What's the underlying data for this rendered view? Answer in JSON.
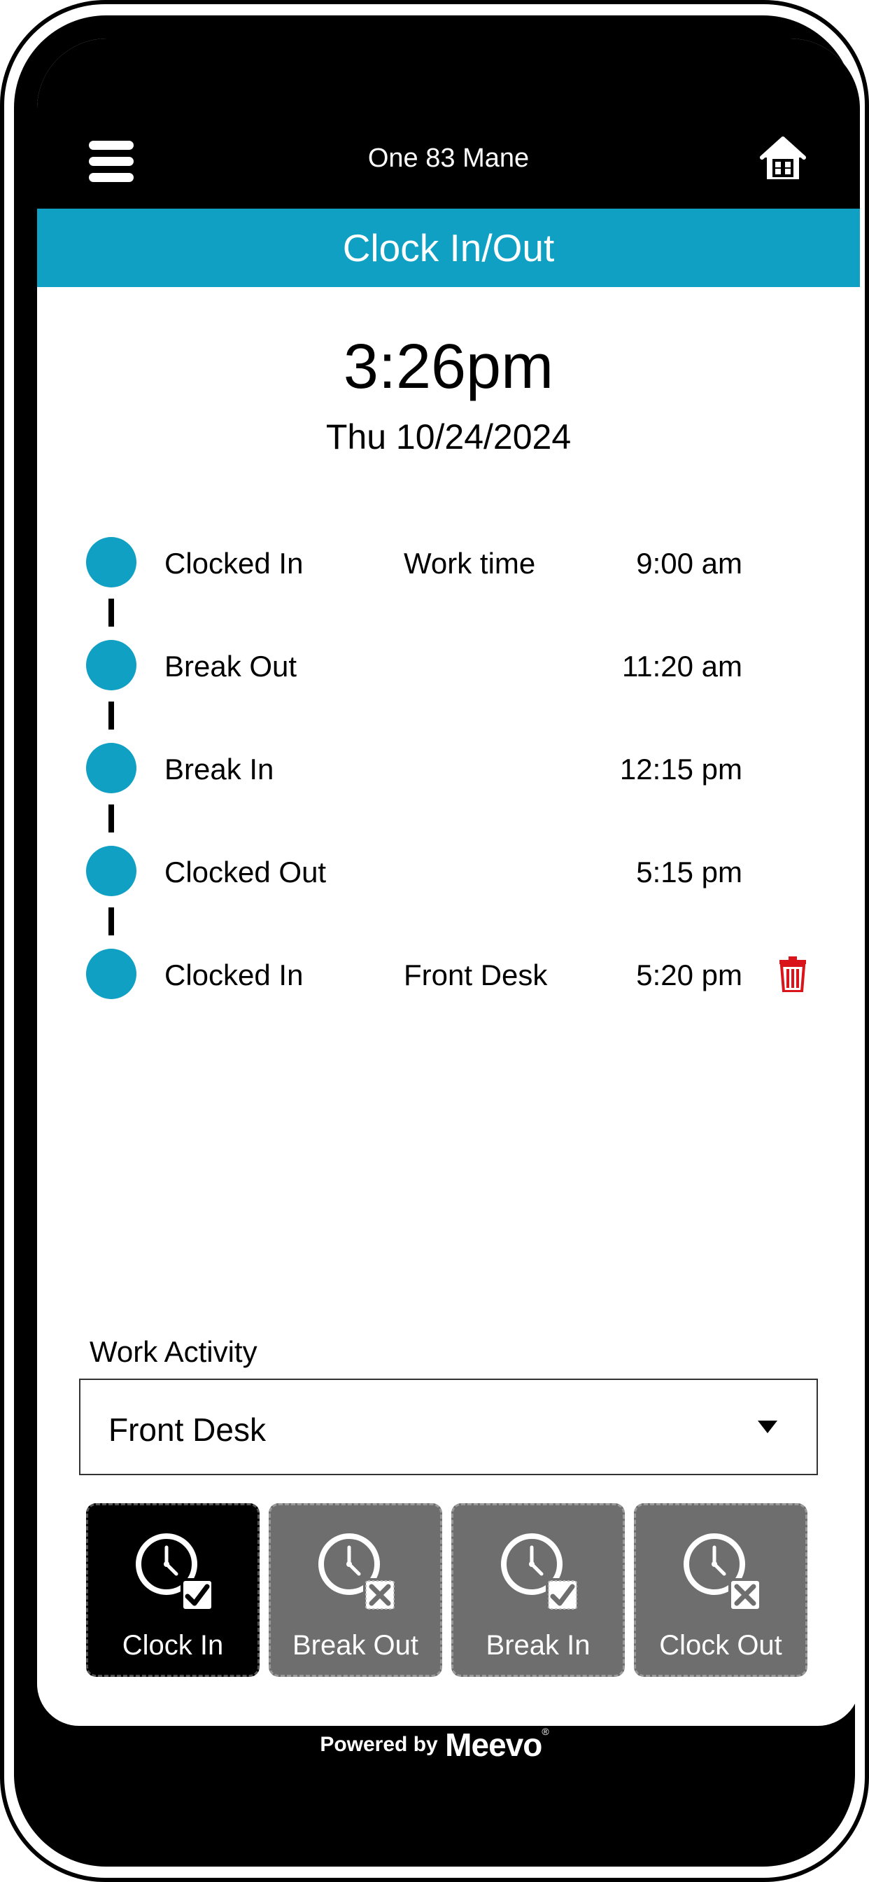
{
  "header": {
    "salon_name": "One 83 Mane",
    "menu_icon": "hamburger-menu-icon",
    "home_icon": "home-icon"
  },
  "title_bar": {
    "title": "Clock In/Out"
  },
  "clock": {
    "time": "3:26pm",
    "date": "Thu 10/24/2024"
  },
  "timeline": [
    {
      "label": "Clocked In",
      "activity": "Work time",
      "time": "9:00 am",
      "deletable": false
    },
    {
      "label": "Break Out",
      "activity": "",
      "time": "11:20 am",
      "deletable": false
    },
    {
      "label": "Break In",
      "activity": "",
      "time": "12:15 pm",
      "deletable": false
    },
    {
      "label": "Clocked Out",
      "activity": "",
      "time": "5:15 pm",
      "deletable": false
    },
    {
      "label": "Clocked In",
      "activity": "Front Desk",
      "time": "5:20 pm",
      "deletable": true
    }
  ],
  "work_activity": {
    "label": "Work Activity",
    "selected": "Front Desk"
  },
  "actions": [
    {
      "label": "Clock In",
      "state": "active",
      "icon": "clock-check-icon"
    },
    {
      "label": "Break Out",
      "state": "disabled",
      "icon": "clock-x-icon"
    },
    {
      "label": "Break In",
      "state": "disabled",
      "icon": "clock-check-icon"
    },
    {
      "label": "Clock Out",
      "state": "disabled",
      "icon": "clock-x-icon"
    }
  ],
  "footer": {
    "powered_by": "Powered by",
    "brand": "Meevo",
    "registered": "®"
  },
  "colors": {
    "accent": "#10a0c4",
    "delete": "#d9141b",
    "disabled_button": "#6e6e6e"
  }
}
